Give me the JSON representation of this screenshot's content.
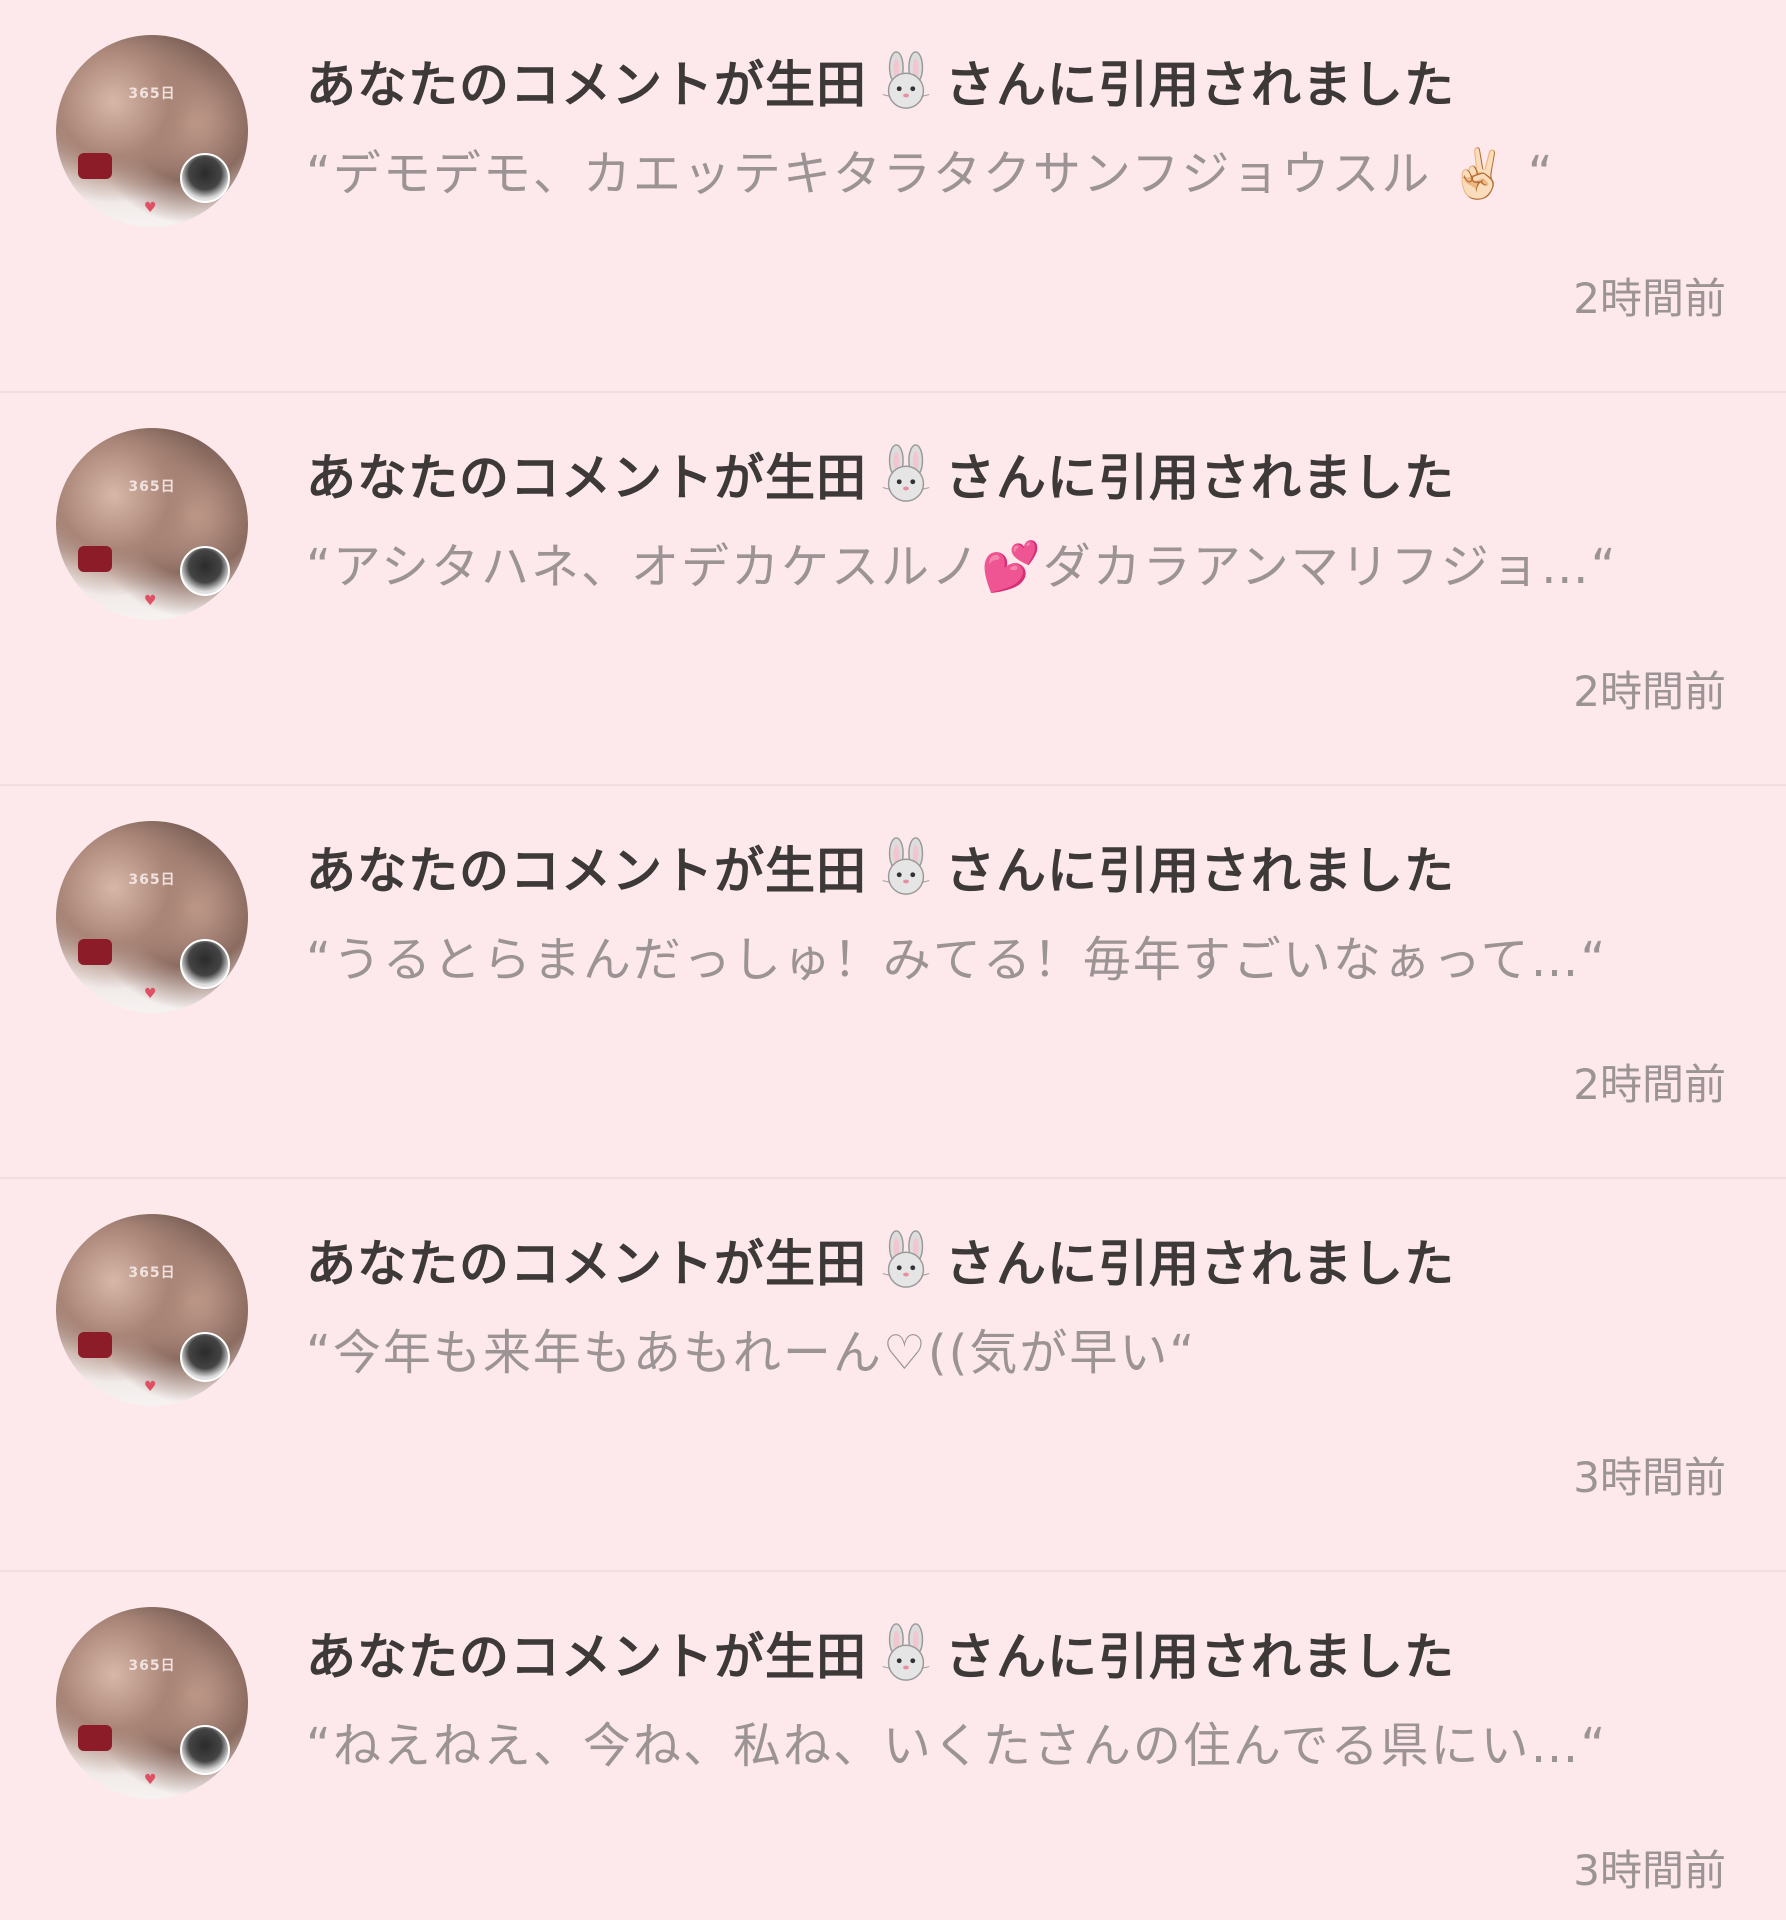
{
  "notifications": [
    {
      "title_prefix": "あなたのコメントが生田",
      "title_suffix": "さんに引用されました",
      "quote_text": "“デモデモ、カエッテキタラタクサンフジョウスル ✌🏻 “",
      "time": "2時間前"
    },
    {
      "title_prefix": "あなたのコメントが生田",
      "title_suffix": "さんに引用されました",
      "quote_text": "“アシタハネ、オデカケスルノ💕ダカラアンマリフジョ…“",
      "time": "2時間前"
    },
    {
      "title_prefix": "あなたのコメントが生田",
      "title_suffix": "さんに引用されました",
      "quote_text": "“うるとらまんだっしゅ！みてる！毎年すごいなぁって…“",
      "time": "2時間前"
    },
    {
      "title_prefix": "あなたのコメントが生田",
      "title_suffix": "さんに引用されました",
      "quote_text": "“今年も来年もあもれーん♡((気が早い“",
      "time": "3時間前"
    },
    {
      "title_prefix": "あなたのコメントが生田",
      "title_suffix": "さんに引用されました",
      "quote_text": "“ねえねえ、今ね、私ね、いくたさんの住んでる県にい…“",
      "time": "3時間前"
    }
  ],
  "avatar": {
    "overlay_text": "365日",
    "heart_icon": "heart-icon",
    "name_icon": "rabbit-icon"
  },
  "colors": {
    "background": "#fde9ec",
    "title": "#3d3939",
    "muted": "#9c9494",
    "divider": "#f3dde1"
  }
}
